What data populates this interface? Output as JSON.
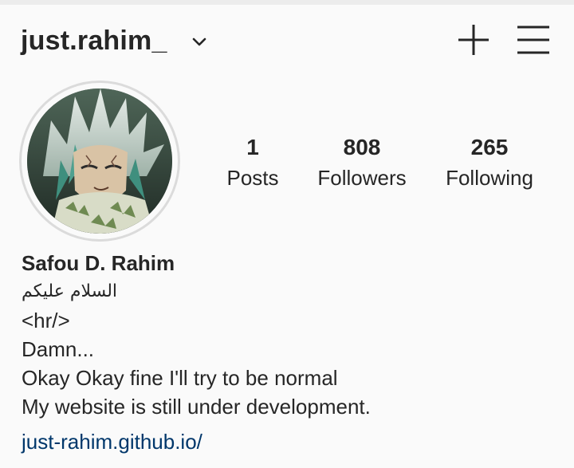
{
  "header": {
    "username": "just.rahim_"
  },
  "stats": {
    "posts": {
      "count": "1",
      "label": "Posts"
    },
    "followers": {
      "count": "808",
      "label": "Followers"
    },
    "following": {
      "count": "265",
      "label": "Following"
    }
  },
  "bio": {
    "full_name": "Safou D. Rahim",
    "lines": [
      "السلام عليكم",
      "<hr/>",
      "Damn...",
      "Okay Okay fine I'll try to be normal",
      "My website is still under development."
    ],
    "link": "just-rahim.github.io/"
  },
  "colors": {
    "text": "#262626",
    "link": "#00376b",
    "background": "#fafafa",
    "avatar_ring": "#dbdbdb"
  },
  "icons": {
    "username_dropdown": "chevron-down-icon",
    "create": "plus-icon",
    "menu": "hamburger-menu-icon"
  }
}
